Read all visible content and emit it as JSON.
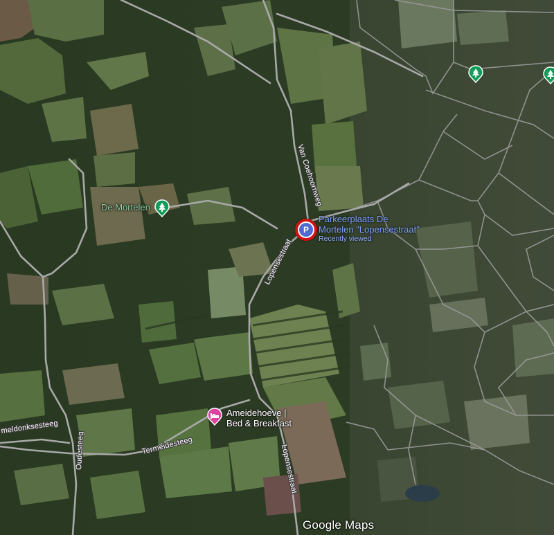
{
  "colors": {
    "forest_dark": "#233019",
    "forest_mid": "#2f4126",
    "field_light": "#5e7446",
    "field_mid": "#4a6036",
    "road": "#a7a7a7",
    "parcel_line": "#9a9a9a",
    "marker_red": "#d01212",
    "marker_blue": "#4f6bd3",
    "park_green": "#0f9d58",
    "lodging_pink": "#e040a0",
    "label_blue": "#7aa1ff",
    "label_green": "#8fd19e",
    "label_white": "#ffffff"
  },
  "road_labels": {
    "van_coehoornweg": "Van Coehoornweg",
    "lopensestraat_1": "Lopensestraat",
    "lopensestraat_2": "Lopensestraat",
    "termeidesteeg": "Termeidesteeg",
    "oudesteeg": "Oudesteeg",
    "meldonksesteeg": "meldonksesteeg"
  },
  "pois": {
    "de_mortelen": {
      "name": "De Mortelen",
      "icon": "tree-icon"
    },
    "ameidehoeve": {
      "line1": "Ameidehoeve |",
      "line2": "Bed & Breakfast",
      "icon": "bed-icon"
    },
    "parking": {
      "icon_glyph": "P",
      "name_line1": "Parkeerplaats De",
      "name_line2": "Mortelen \"Lopensestraat\"",
      "subtitle": "Recently viewed"
    },
    "park_pin_1": {
      "icon": "tree-icon"
    },
    "park_pin_2": {
      "icon": "tree-icon"
    }
  },
  "attribution": {
    "logo": "Google Maps"
  }
}
